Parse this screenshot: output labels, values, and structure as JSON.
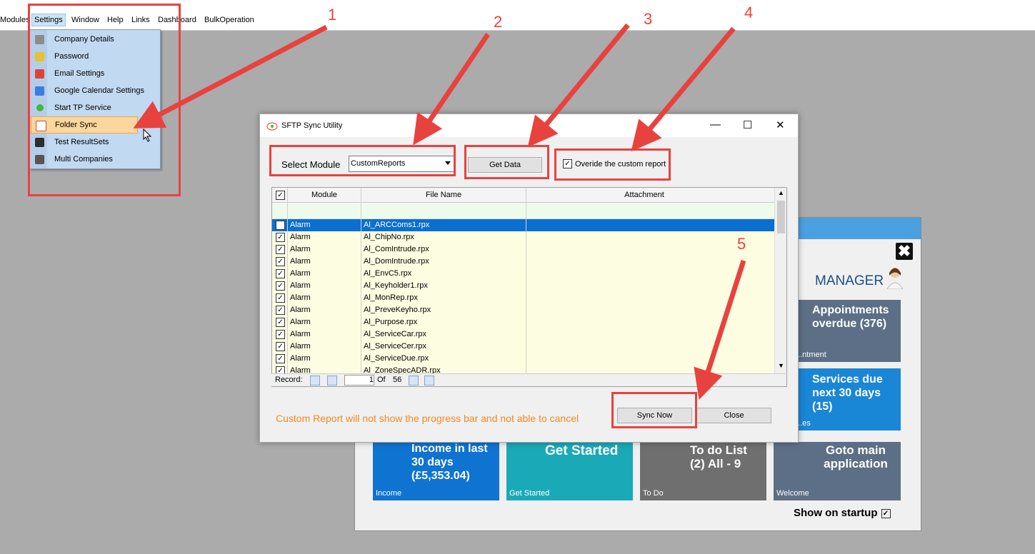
{
  "menubar": {
    "items": [
      "Modules",
      "Settings",
      "Window",
      "Help",
      "Links",
      "Dashboard",
      "BulkOperation"
    ]
  },
  "settings_menu": {
    "items": [
      "Company Details",
      "Password",
      "Email Settings",
      "Google Calendar Settings",
      "Start TP Service",
      "Folder Sync",
      "Test ResultSets",
      "Multi Companies"
    ],
    "highlighted": "Folder Sync"
  },
  "annotations": [
    "1",
    "2",
    "3",
    "4",
    "5"
  ],
  "dashboard": {
    "close_label": "✖",
    "role": "MANAGER",
    "tiles": [
      {
        "big": "Appointments overdue (376)",
        "small": "...ntment",
        "color": "#5c6f86"
      },
      {
        "big": "Services due next 30 days (15)",
        "small": "...es",
        "color": "#1a86d6"
      },
      {
        "big": "Income in last 30 days (£5,353.04)",
        "small": "Income",
        "color": "#0f73d1"
      },
      {
        "big": "Get Started",
        "small": "Get Started",
        "color": "#1aa9b7"
      },
      {
        "big": "To do List (2) All - 9",
        "small": "To Do",
        "color": "#6f6f6f"
      },
      {
        "big": "Goto main application",
        "small": "Welcome",
        "color": "#5c6f86"
      }
    ],
    "show_on_startup": "Show on startup"
  },
  "dialog": {
    "title": "SFTP Sync Utility",
    "controls": {
      "minimize": "—",
      "maximize": "☐",
      "close": "✕"
    },
    "select_module_label": "Select Module",
    "module_value": "CustomReports",
    "get_data_label": "Get Data",
    "override_label": "Overide the custom report",
    "override_checked": true,
    "grid": {
      "columns": [
        "Module",
        "File Name",
        "Attachment"
      ],
      "rows": [
        {
          "module": "Alarm",
          "file": "Al_ARCComs1.rpx"
        },
        {
          "module": "Alarm",
          "file": "Al_ChipNo.rpx"
        },
        {
          "module": "Alarm",
          "file": "Al_ComIntrude.rpx"
        },
        {
          "module": "Alarm",
          "file": "Al_DomIntrude.rpx"
        },
        {
          "module": "Alarm",
          "file": "Al_EnvC5.rpx"
        },
        {
          "module": "Alarm",
          "file": "Al_Keyholder1.rpx"
        },
        {
          "module": "Alarm",
          "file": "Al_MonRep.rpx"
        },
        {
          "module": "Alarm",
          "file": "Al_PreveKeyho.rpx"
        },
        {
          "module": "Alarm",
          "file": "Al_Purpose.rpx"
        },
        {
          "module": "Alarm",
          "file": "Al_ServiceCar.rpx"
        },
        {
          "module": "Alarm",
          "file": "Al_ServiceCer.rpx"
        },
        {
          "module": "Alarm",
          "file": "Al_ServiceDue.rpx"
        },
        {
          "module": "Alarm",
          "file": "Al_ZoneSpecADR.rpx"
        }
      ]
    },
    "navigator": {
      "record_label": "Record:",
      "current": "1",
      "of_label": "Of",
      "total": "56"
    },
    "warning": "Custom Report will not show the progress bar and not able to cancel",
    "sync_now_label": "Sync Now",
    "close_label": "Close"
  },
  "colors": {
    "annotation": "#e8423f",
    "warning": "#f08a24",
    "selection": "#0a6fd1"
  }
}
